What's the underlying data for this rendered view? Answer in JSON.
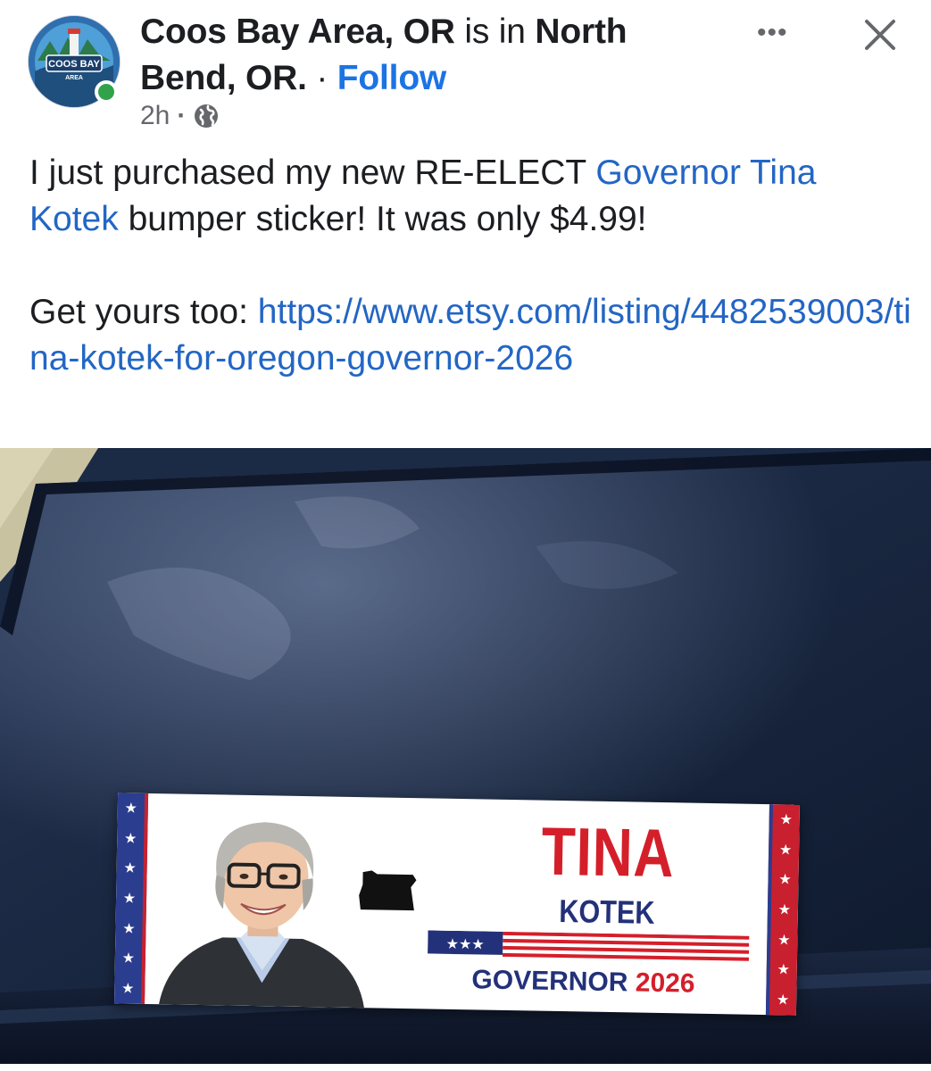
{
  "header": {
    "page_name": "Coos Bay Area, OR",
    "checkin_connector": "is in",
    "location": "North Bend, OR.",
    "separator": "·",
    "follow_label": "Follow",
    "timestamp": "2h",
    "meta_separator": "·",
    "privacy_icon": "globe-icon",
    "more_icon": "more-options-icon",
    "more_glyph": "•••",
    "close_icon": "close-icon"
  },
  "avatar": {
    "logo_line1": "COOS BAY",
    "logo_line2": "AREA",
    "online_status_color": "#31a24c"
  },
  "post": {
    "line1_a": "I just purchased my new RE-ELECT ",
    "mention_link": "Governor Tina Kotek",
    "line1_b": " bumper sticker! It was only $4.99!",
    "cta_text": "Get yours too: ",
    "url_text": "https://www.etsy.com/listing/4482539003/tina-kotek-for-oregon-governor-2026"
  },
  "sticker": {
    "name_first": "TINA",
    "name_last": "KOTEK",
    "office": "GOVERNOR",
    "year": "2026",
    "star_glyph": "★"
  },
  "colors": {
    "link": "#2366c4",
    "follow": "#1b74e4",
    "sticker_red": "#d41f2b",
    "sticker_blue": "#23317a"
  }
}
